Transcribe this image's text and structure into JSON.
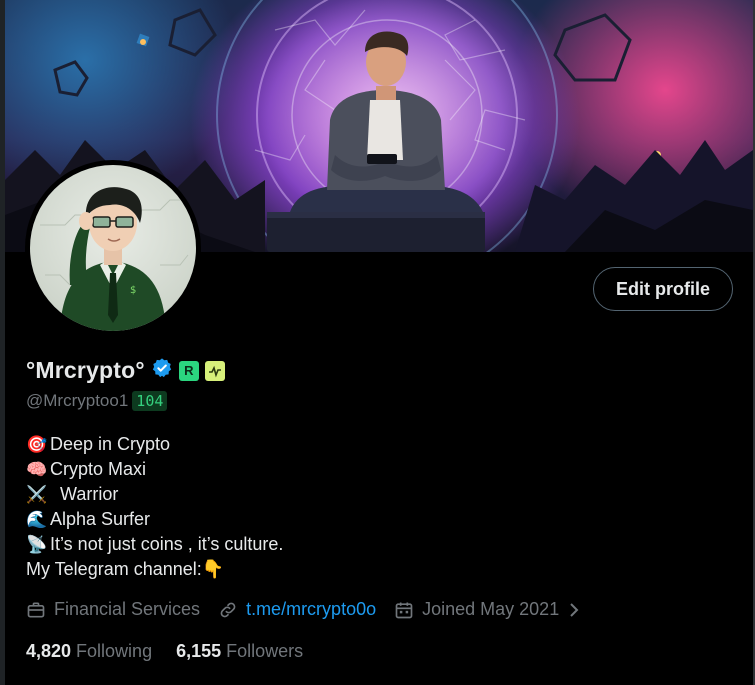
{
  "profile": {
    "display_name": "°Mrcrypto°",
    "handle": "@Mrcryptoo1",
    "score": "104",
    "badge_letter": "R",
    "edit_button_label": "Edit profile",
    "bio": [
      {
        "emoji": "🎯",
        "text": "Deep in Crypto"
      },
      {
        "emoji": "🧠",
        "text": "Crypto Maxi"
      },
      {
        "emoji": "⚔️",
        "text": "  Warrior"
      },
      {
        "emoji": "🌊",
        "text": "Alpha Surfer"
      },
      {
        "emoji": "📡",
        "text": "It’s not just coins , it’s culture."
      }
    ],
    "bio_last_line": "My Telegram channel:",
    "bio_last_emoji": "👇",
    "category": "Financial Services",
    "link": "t.me/mrcrypto0o",
    "joined": "Joined May 2021",
    "following_count": "4,820",
    "following_label": "Following",
    "followers_count": "6,155",
    "followers_label": "Followers"
  },
  "icons": {
    "verified": "verified-badge-icon",
    "category": "briefcase-icon",
    "link": "link-icon",
    "joined": "calendar-icon",
    "chevron": "chevron-right-icon"
  },
  "colors": {
    "background": "#000000",
    "text_primary": "#e7e9ea",
    "text_secondary": "#71767b",
    "link": "#1d9bf0",
    "verified": "#1d9bf0",
    "score_text": "#35d07f",
    "score_bg": "#0d3a1f"
  }
}
